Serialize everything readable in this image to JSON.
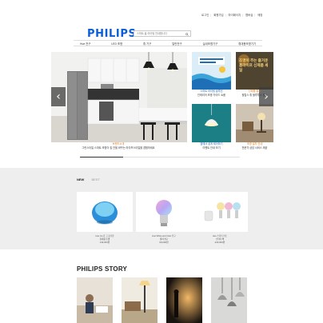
{
  "top_links": [
    "로그인",
    "회원가입",
    "마이페이지",
    "멤버십",
    "매장"
  ],
  "logo": "PHILIPS",
  "search": {
    "placeholder": "스마트 홈 라이팅 안내합니다"
  },
  "nav": [
    "Hue 전구",
    "LED 조명",
    "휴 기구",
    "일반전구",
    "실내조명기구",
    "휴대용조명기기"
  ],
  "hero": {
    "captions": [
      {
        "title": "브랜드소개",
        "sub": "그린스타일 스마트 조명이 집 안을 바꾸는 라이프스타일을 경험하세요"
      },
      {
        "title": "스마트 라이팅 솔루션",
        "sub": "인테리어 조명 가이드 쇼룸"
      },
      {
        "title": "신제품 출시",
        "sub": "필립스 휴 블루투스 출시"
      },
      {
        "title": "앱에서 쉽게 제어하기",
        "sub": "이벤트 안내 보기"
      },
      {
        "title": "조명 설치 안내",
        "sub": "전문가 상담 서비스 제공"
      }
    ],
    "promo_text": "조명이 주는 즐거운 홈라이프 신제품 세일"
  },
  "tabs": [
    "NEW",
    "BEST"
  ],
  "products": [
    {
      "name": "Hue Go 휴 고 포터블",
      "tag": "휴대용 조명",
      "price": "139,000원"
    },
    {
      "name": "Hue White and Color 전구",
      "tag": "컬러 전구",
      "price": "69,000원"
    },
    {
      "name": "Hue 스타터 키트",
      "tag": "스타터 팩",
      "price": "229,000원"
    }
  ],
  "story_title": "PHILIPS STORY",
  "colors": {
    "brand": "#0b5ed7",
    "accent": "#e07a18"
  },
  "icons": [
    "search-icon",
    "chevron-left-icon",
    "chevron-right-icon"
  ]
}
